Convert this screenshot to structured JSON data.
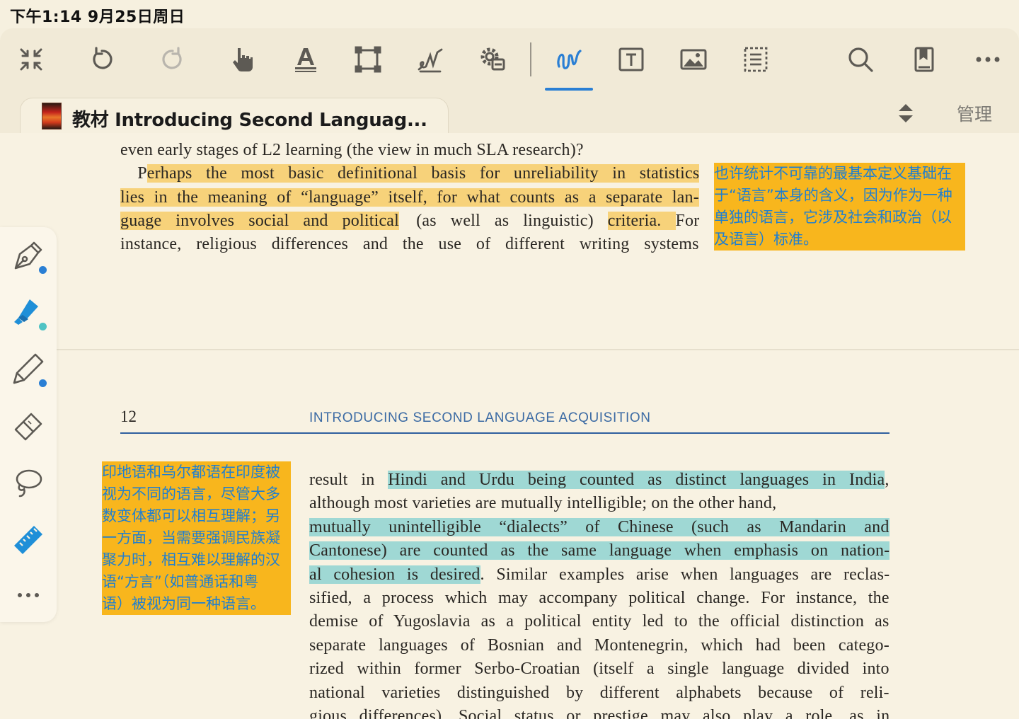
{
  "status_bar": {
    "time": "下午1:14   9月25日周日"
  },
  "toolbar": {
    "icons": [
      "collapse-icon",
      "undo-icon",
      "redo-icon",
      "hand-pointer-icon",
      "text-underline-icon",
      "crop-select-icon",
      "signature-icon",
      "settings-gear-icon",
      "freehand-draw-icon",
      "text-box-icon",
      "image-icon",
      "form-list-icon",
      "search-icon",
      "bookmark-icon",
      "more-icon"
    ],
    "active_tool": "freehand-draw-icon",
    "accent_color": "#2a7fd4"
  },
  "tab_bar": {
    "document_tab_title": "教材 Introducing Second Languag...",
    "manage_label": "管理"
  },
  "document": {
    "page_top": {
      "lines": [
        [
          {
            "t": "even early stages of L2 learning (the view in much SLA research)?"
          }
        ],
        [
          {
            "t": "   P"
          },
          {
            "t": "erhaps the most basic definitional basis for unreliability in statistics",
            "hl": "y"
          }
        ],
        [
          {
            "t": "lies in the meaning of “language” itself, for what counts as a separate lan-",
            "hl": "y"
          }
        ],
        [
          {
            "t": "guage involves social and political",
            "hl": "y"
          },
          {
            "t": " (as well as linguistic) "
          },
          {
            "t": "criteria. ",
            "hl": "y"
          },
          {
            "t": "For"
          }
        ],
        [
          {
            "t": "instance, religious differences and the use of different writing systems"
          }
        ]
      ],
      "note": [
        "也许统计不可靠的最基本定义基础在",
        "于“语言”本身的含义，因为作为一种",
        "单独的语言，它涉及社会和政治（以",
        "及语言）标准。"
      ]
    },
    "page_next": {
      "page_number": "12",
      "running_head": "INTRODUCING SECOND LANGUAGE ACQUISITION",
      "lines": [
        [
          {
            "t": "result in "
          },
          {
            "t": "Hindi and Urdu being counted as distinct languages in India",
            "hl": "c"
          },
          {
            "t": ","
          }
        ],
        [
          {
            "t": "although most varieties are mutually intelligible; on the other hand,"
          }
        ],
        [
          {
            "t": "mutually unintelligible “dialects” of Chinese (such as Mandarin and",
            "hl": "c"
          }
        ],
        [
          {
            "t": "Cantonese) are counted as the same language when emphasis on nation-",
            "hl": "c"
          }
        ],
        [
          {
            "t": "al cohesion is desired",
            "hl": "c"
          },
          {
            "t": ". Similar examples arise when languages are reclas-"
          }
        ],
        [
          {
            "t": "sified, a process which may accompany political change. For instance, the"
          }
        ],
        [
          {
            "t": "demise of Yugoslavia as a political entity led to the official distinction as"
          }
        ],
        [
          {
            "t": "separate languages of Bosnian and Montenegrin, which had been catego-"
          }
        ],
        [
          {
            "t": "rized within former Serbo-Croatian (itself a single language divided into"
          }
        ],
        [
          {
            "t": "national varieties distinguished by different alphabets because of reli-"
          }
        ],
        [
          {
            "t": "gious differences). Social status or prestige may also play a role, as in"
          }
        ]
      ],
      "note": [
        "印地语和乌尔都语在印度被",
        "视为不同的语言，尽管大多",
        "数变体都可以相互理解；另",
        "一方面，当需要强调民族凝",
        "聚力时，相互难以理解的汉",
        "语“方言”（如普通话和粤",
        "语）被视为同一种语言。"
      ]
    },
    "highlight_colors": {
      "yellow": "#f7d27a",
      "cyan": "#9fd8d4",
      "note_bg": "#f8b61d",
      "note_text": "#1f7fd0"
    }
  },
  "tool_palette": {
    "tools": [
      "fountain-pen-icon",
      "highlighter-icon",
      "pencil-icon",
      "eraser-icon",
      "lasso-icon",
      "ruler-icon",
      "more-tools-icon"
    ],
    "selected_tool": "highlighter-icon"
  }
}
